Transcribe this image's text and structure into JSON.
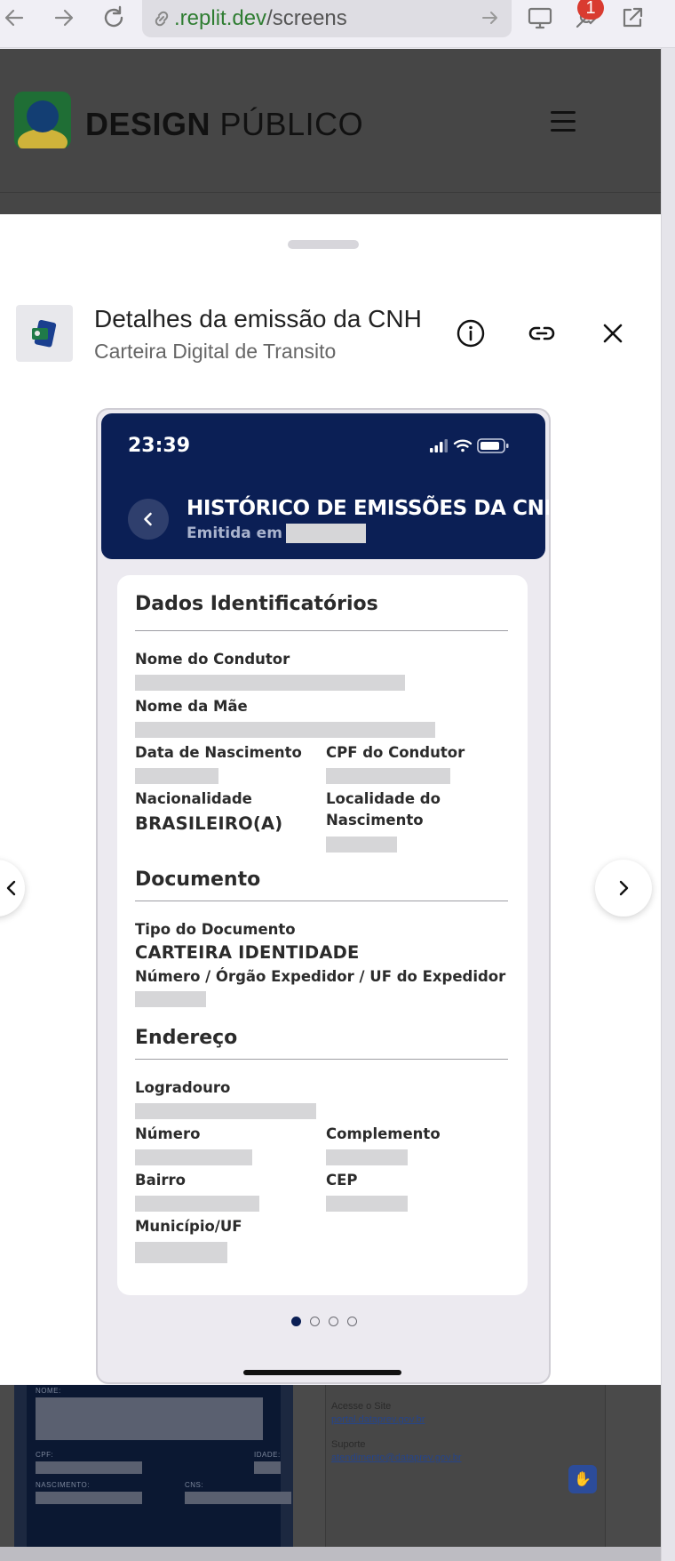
{
  "browser": {
    "url_host": ".replit.dev",
    "url_path": "/screens",
    "notification_count": "1"
  },
  "site": {
    "brand_bold": "DESIGN",
    "brand_light": "PÚBLICO",
    "footer": {
      "field_nome": "NOME:",
      "field_cpf": "CPF:",
      "field_idade": "IDADE:",
      "field_nascimento": "NASCIMENTO:",
      "field_cns": "CNS:",
      "access_label": "Acesse o Site",
      "access_link": "portal.dataprev.gov.br",
      "support_label": "Suporte",
      "support_link": "atendimento@dataprev.gov.br"
    }
  },
  "sheet": {
    "title": "Detalhes da emissão da CNH",
    "subtitle": "Carteira Digital de Transito"
  },
  "phone": {
    "time": "23:39",
    "header_title": "HISTÓRICO DE EMISSÕES DA CNH",
    "header_subtitle": "Emitida em",
    "sections": {
      "identificacao": "Dados Identificatórios",
      "documento": "Documento",
      "endereco": "Endereço"
    },
    "fields": {
      "nome_condutor": "Nome do Condutor",
      "nome_mae": "Nome da Mãe",
      "data_nascimento": "Data de Nascimento",
      "cpf_condutor": "CPF do Condutor",
      "nacionalidade": "Nacionalidade",
      "nacionalidade_valor": "BRASILEIRO(A)",
      "localidade_nascimento": "Localidade do Nascimento",
      "tipo_documento": "Tipo do Documento",
      "tipo_documento_valor": "CARTEIRA IDENTIDADE",
      "numero_orgao_uf": "Número / Órgão Expedidor / UF do Expedidor",
      "logradouro": "Logradouro",
      "numero": "Número",
      "complemento": "Complemento",
      "bairro": "Bairro",
      "cep": "CEP",
      "municipio_uf": "Município/UF"
    },
    "page_count": 4,
    "active_page": 1
  },
  "colors": {
    "phone_header": "#0b1f55",
    "link_green": "#2f7d32",
    "badge_red": "#d93b30"
  },
  "icons": [
    "back-arrow-icon",
    "forward-arrow-icon",
    "reload-icon",
    "link-icon",
    "device-icon",
    "wrench-icon",
    "external-link-icon",
    "menu-icon",
    "info-icon",
    "chain-link-icon",
    "close-icon",
    "chevron-left-icon",
    "chevron-right-icon",
    "signal-icon",
    "wifi-icon",
    "battery-icon"
  ]
}
